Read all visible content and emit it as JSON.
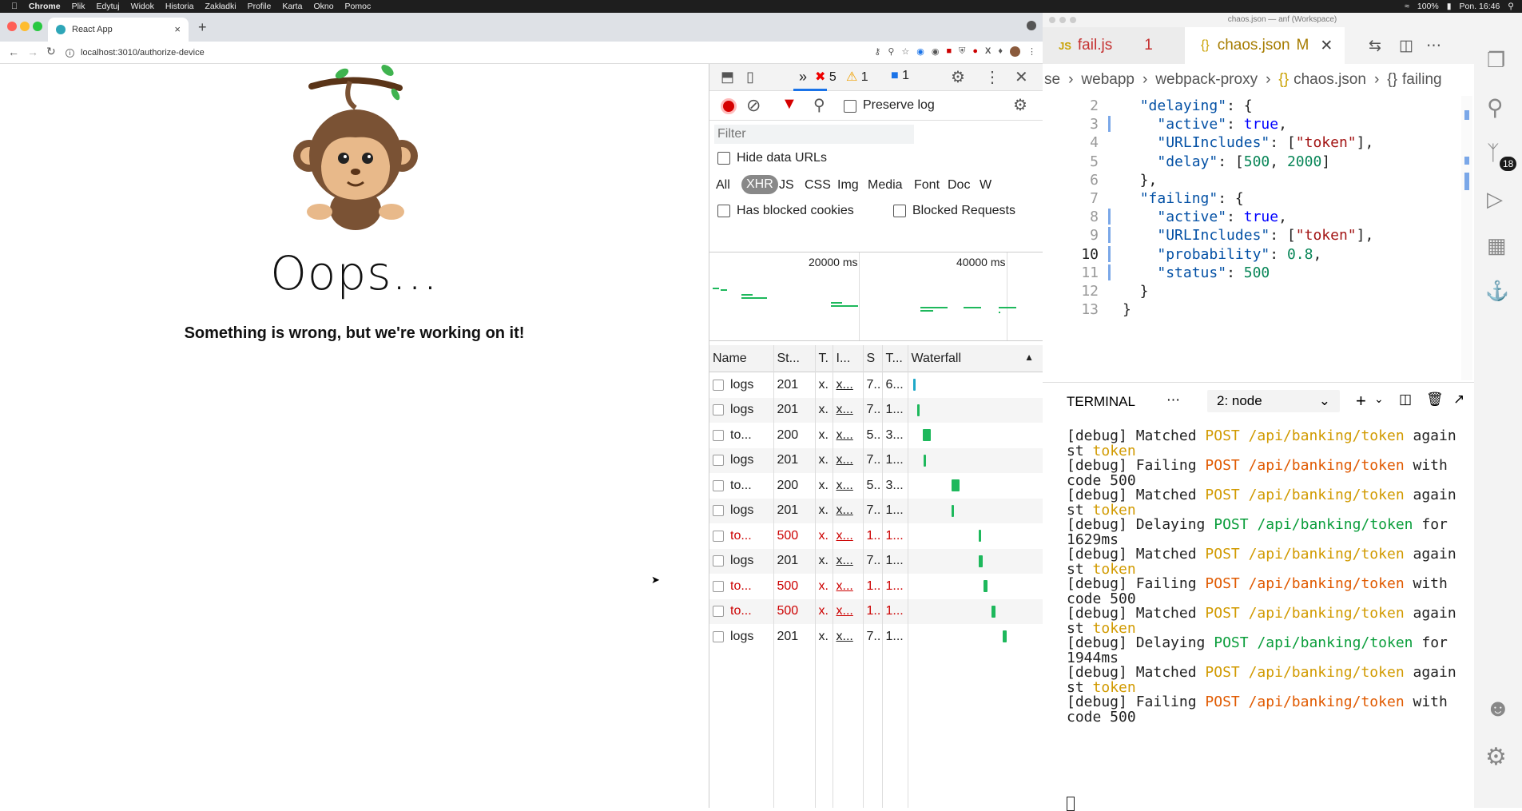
{
  "menubar": {
    "apple": "",
    "app": "Chrome",
    "items": [
      "Plik",
      "Edytuj",
      "Widok",
      "Historia",
      "Zakładki",
      "Profile",
      "Karta",
      "Okno",
      "Pomoc"
    ],
    "battery": "100%",
    "clock": "Pon. 16:46"
  },
  "browser": {
    "tab_title": "React App",
    "url": "localhost:3010/authorize-device"
  },
  "page": {
    "heading": "Oops...",
    "subheading": "Something is wrong, but we're working on it!"
  },
  "devtools": {
    "error_count": "5",
    "warning_count": "1",
    "message_count": "1",
    "preserve_log": "Preserve log",
    "filter_placeholder": "Filter",
    "hide_data_urls": "Hide data URLs",
    "types": [
      "All",
      "XHR",
      "JS",
      "CSS",
      "Img",
      "Media",
      "Font",
      "Doc",
      "W"
    ],
    "active_type": "XHR",
    "has_blocked_cookies": "Has blocked cookies",
    "blocked_requests": "Blocked Requests",
    "timeline_labels": [
      "20000 ms",
      "40000 ms"
    ],
    "columns": [
      "Name",
      "St...",
      "T.",
      "I...",
      "S",
      "T...",
      "Waterfall"
    ],
    "rows": [
      {
        "name": "logs",
        "status": "201",
        "type": "x.",
        "init": "x...",
        "size": "7..",
        "time": "6...",
        "error": false
      },
      {
        "name": "logs",
        "status": "201",
        "type": "x.",
        "init": "x...",
        "size": "7..",
        "time": "1...",
        "error": false
      },
      {
        "name": "to...",
        "status": "200",
        "type": "x.",
        "init": "x...",
        "size": "5..",
        "time": "3...",
        "error": false
      },
      {
        "name": "logs",
        "status": "201",
        "type": "x.",
        "init": "x...",
        "size": "7..",
        "time": "1...",
        "error": false
      },
      {
        "name": "to...",
        "status": "200",
        "type": "x.",
        "init": "x...",
        "size": "5..",
        "time": "3...",
        "error": false
      },
      {
        "name": "logs",
        "status": "201",
        "type": "x.",
        "init": "x...",
        "size": "7..",
        "time": "1...",
        "error": false
      },
      {
        "name": "to...",
        "status": "500",
        "type": "x.",
        "init": "x...",
        "size": "1..",
        "time": "1...",
        "error": true
      },
      {
        "name": "logs",
        "status": "201",
        "type": "x.",
        "init": "x...",
        "size": "7..",
        "time": "1...",
        "error": false
      },
      {
        "name": "to...",
        "status": "500",
        "type": "x.",
        "init": "x...",
        "size": "1..",
        "time": "1...",
        "error": true
      },
      {
        "name": "to...",
        "status": "500",
        "type": "x.",
        "init": "x...",
        "size": "1..",
        "time": "1...",
        "error": true
      },
      {
        "name": "logs",
        "status": "201",
        "type": "x.",
        "init": "x...",
        "size": "7..",
        "time": "1...",
        "error": false
      }
    ]
  },
  "vscode": {
    "window_title": "chaos.json — anf (Workspace)",
    "tab1_label": "fail.js",
    "tab1_badge": "1",
    "tab2_label": "chaos.json",
    "tab2_badge": "M",
    "breadcrumb": [
      "se",
      "webapp",
      "webpack-proxy",
      "chaos.json",
      "failing"
    ],
    "scm_badge": "18",
    "code_lines": [
      {
        "n": "2",
        "html": "  <span class='k'>\"delaying\"</span>: {"
      },
      {
        "n": "3",
        "html": "    <span class='k'>\"active\"</span>: <span class='b'>true</span>,"
      },
      {
        "n": "4",
        "html": "    <span class='k'>\"URLIncludes\"</span>: [<span class='s'>\"token\"</span>],"
      },
      {
        "n": "5",
        "html": "    <span class='k'>\"delay\"</span>: [<span class='n'>500</span>, <span class='n'>2000</span>]"
      },
      {
        "n": "6",
        "html": "  },"
      },
      {
        "n": "7",
        "html": "  <span class='k'>\"failing\"</span>: {"
      },
      {
        "n": "8",
        "html": "    <span class='k'>\"active\"</span>: <span class='b'>true</span>,"
      },
      {
        "n": "9",
        "html": "    <span class='k'>\"URLIncludes\"</span>: [<span class='s'>\"token\"</span>],"
      },
      {
        "n": "10",
        "html": "    <span class='k'>\"probability\"</span>: <span class='n'>0.8</span>,"
      },
      {
        "n": "11",
        "html": "    <span class='k'>\"status\"</span>: <span class='n'>500</span>"
      },
      {
        "n": "12",
        "html": "  }"
      },
      {
        "n": "13",
        "html": "}"
      }
    ],
    "terminal_label": "TERMINAL",
    "terminal_select": "2: node",
    "terminal_lines": [
      "[debug] Matched POST /api/banking/token again",
      "st token",
      "[debug] Failing POST /api/banking/token with",
      "code 500",
      "[debug] Matched POST /api/banking/token again",
      "st token",
      "[debug] Delaying POST /api/banking/token for",
      "1629ms",
      "[debug] Matched POST /api/banking/token again",
      "st token",
      "[debug] Failing POST /api/banking/token with",
      "code 500",
      "[debug] Matched POST /api/banking/token again",
      "st token",
      "[debug] Delaying POST /api/banking/token for",
      "1944ms",
      "[debug] Matched POST /api/banking/token again",
      "st token",
      "[debug] Failing POST /api/banking/token with",
      "code 500"
    ]
  }
}
